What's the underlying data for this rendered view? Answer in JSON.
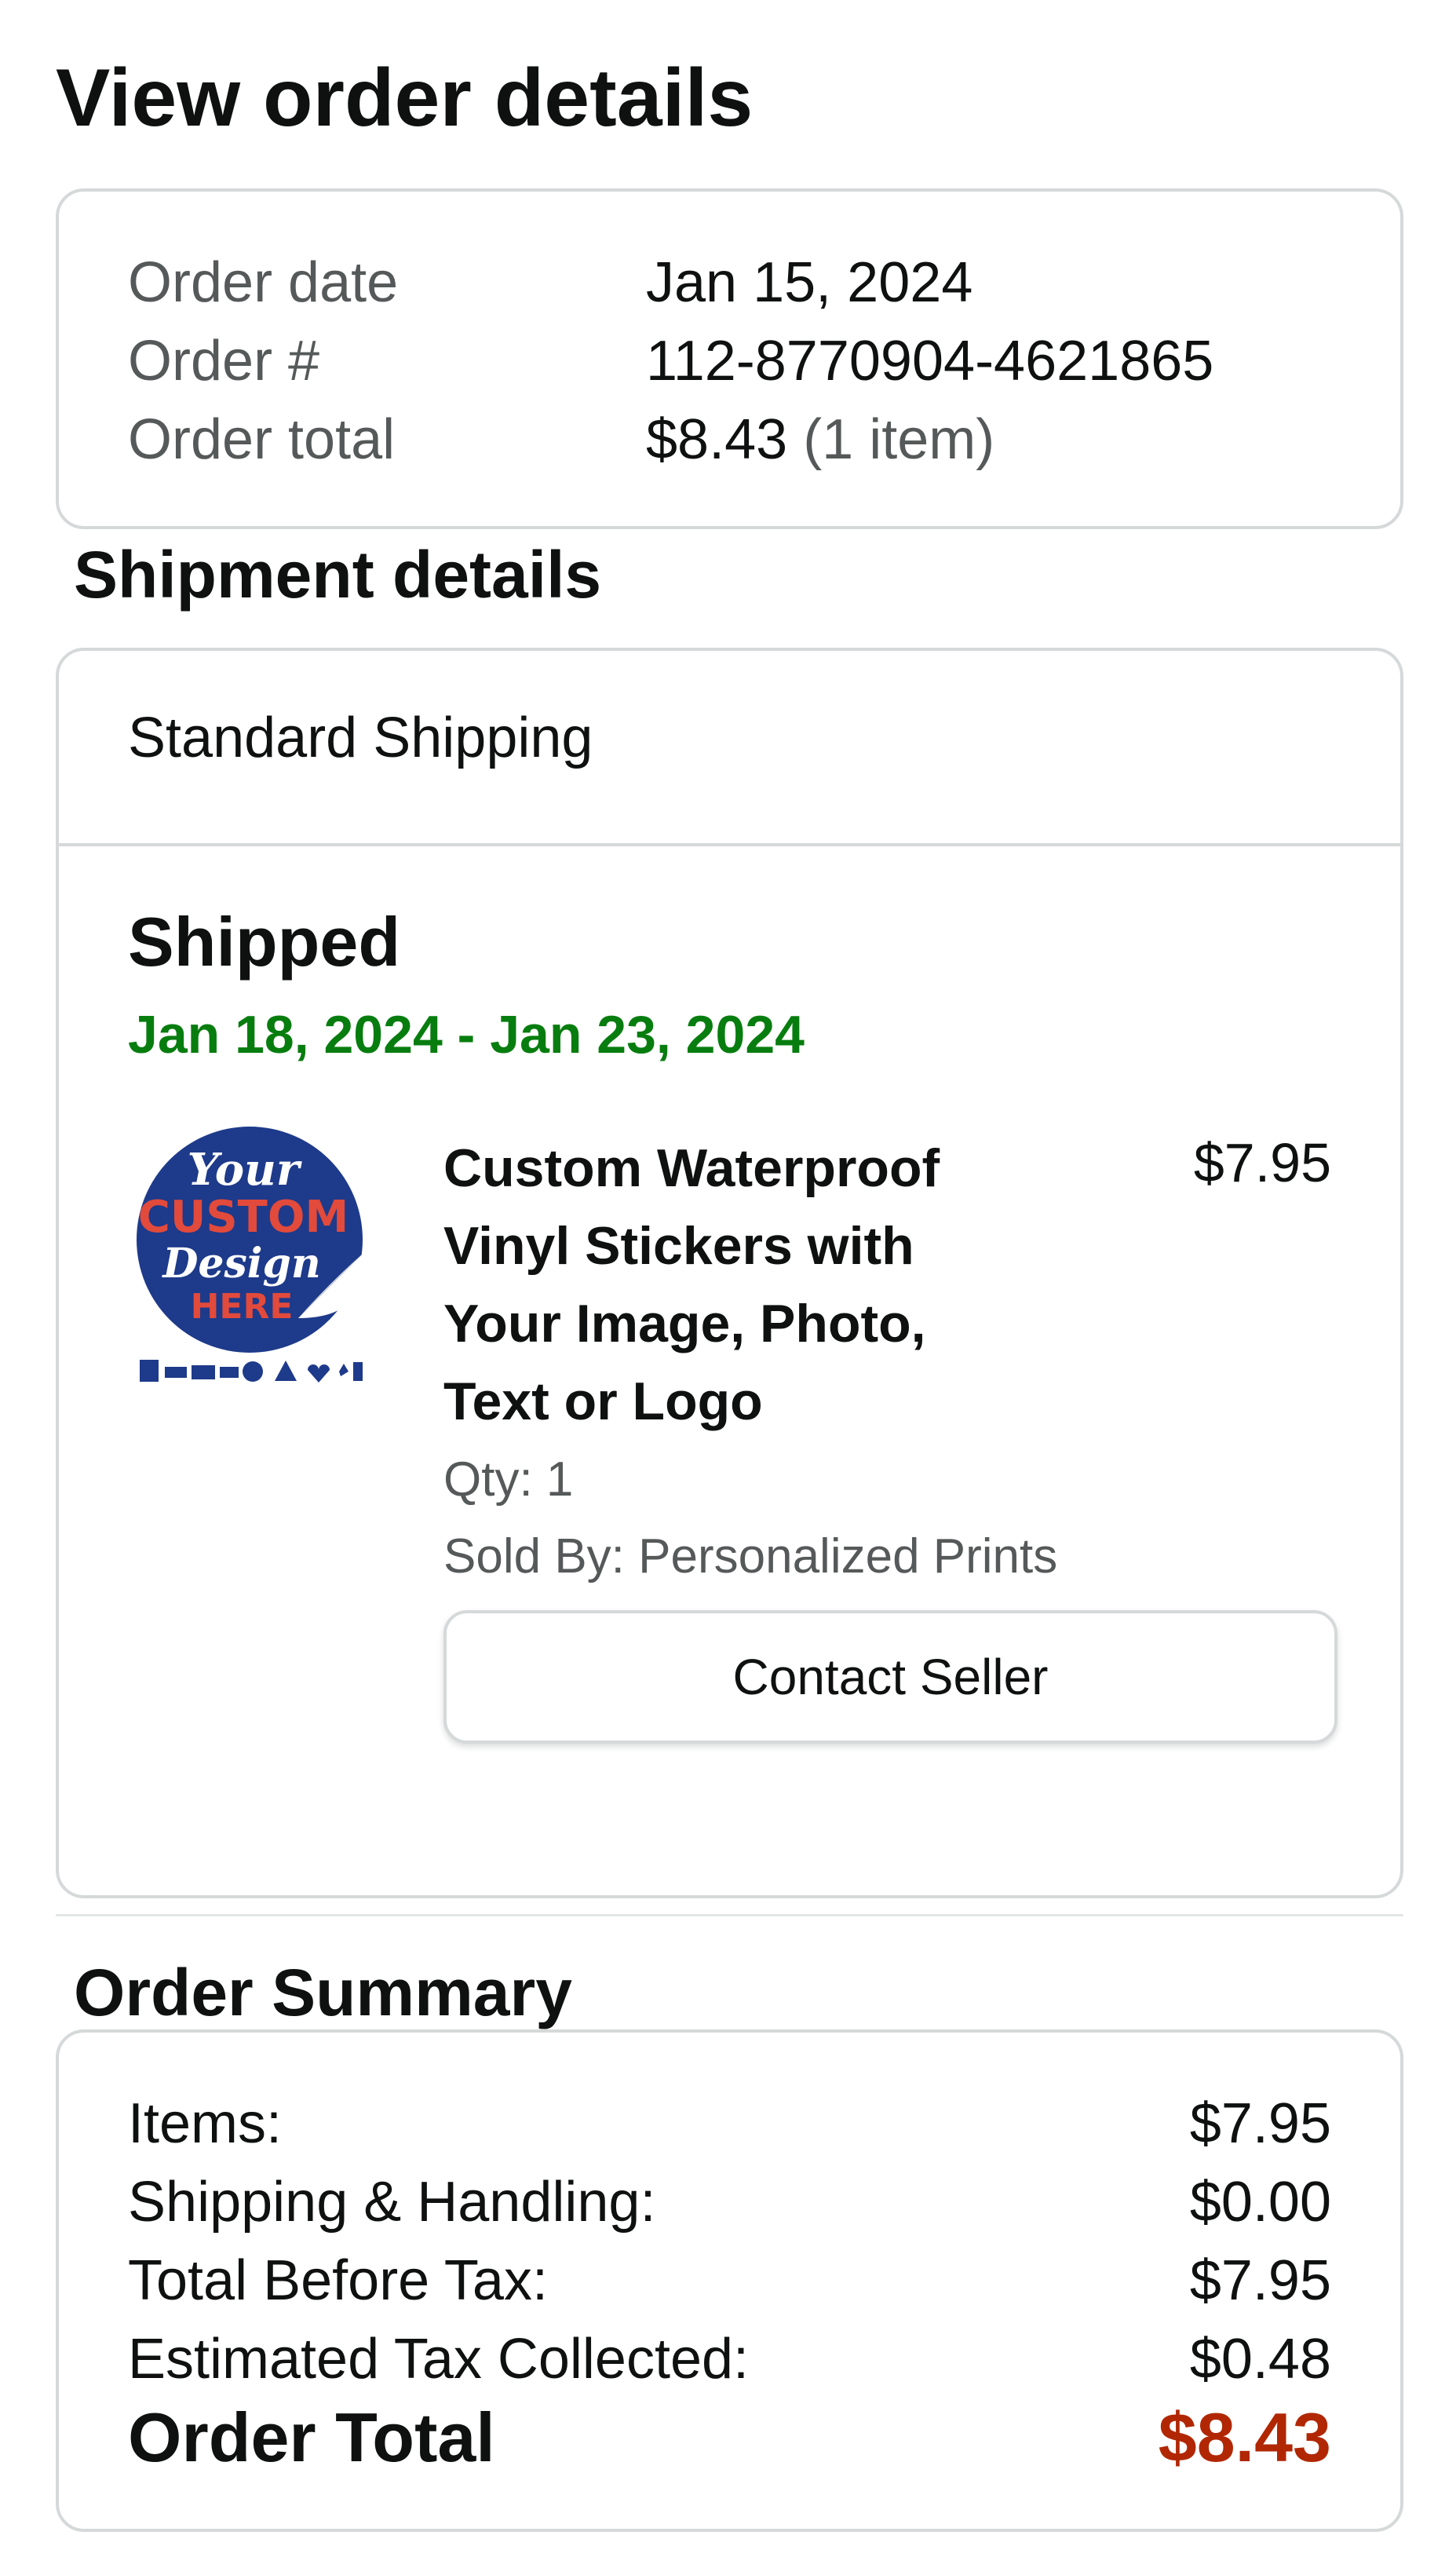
{
  "page": {
    "title": "View order details"
  },
  "order_info": {
    "rows": [
      {
        "label": "Order date",
        "value": "Jan 15, 2024"
      },
      {
        "label": "Order #",
        "value": "112-8770904-4621865"
      },
      {
        "label": "Order total",
        "value": "$8.43",
        "note": "(1 item)"
      }
    ]
  },
  "shipment": {
    "heading": "Shipment details",
    "method": "Standard Shipping",
    "status": "Shipped",
    "delivery_range": "Jan 18, 2024 - Jan 23, 2024",
    "item": {
      "title": "Custom Waterproof Vinyl Stickers with Your Image, Photo, Text or Logo",
      "price": "$7.95",
      "qty": "Qty: 1",
      "sold_by": "Sold By: Personalized Prints",
      "image_icon": "custom-sticker-product-image",
      "image_text": [
        "Your",
        "CUSTOM",
        "Design",
        "HERE"
      ]
    },
    "contact_button": "Contact Seller",
    "colors": {
      "delivery": "#087d0f"
    }
  },
  "summary": {
    "heading": "Order Summary",
    "rows": [
      {
        "label": "Items:",
        "amount": "$7.95"
      },
      {
        "label": "Shipping & Handling:",
        "amount": "$0.00"
      },
      {
        "label": "Total Before Tax:",
        "amount": "$7.95"
      },
      {
        "label": "Estimated Tax Collected:",
        "amount": "$0.48"
      }
    ],
    "total_label": "Order Total",
    "total_amount": "$8.43",
    "colors": {
      "total": "#b12704"
    }
  }
}
